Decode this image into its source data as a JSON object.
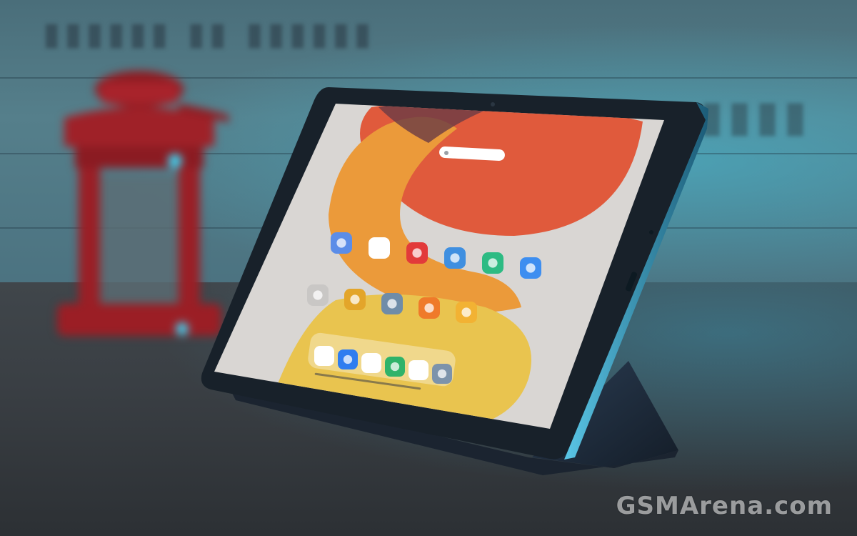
{
  "scene": {
    "description_colors": {
      "wall": "#4f7a86",
      "table": "#3a3f44",
      "lantern": "#a8232b",
      "tablet_frame": "#1f2a33",
      "cover": "#1c2a3a",
      "screen_bg": "#d9d6d3",
      "wallpaper_red": "#e05a3c",
      "wallpaper_orange": "#eb9a3a",
      "wallpaper_yellow": "#e9c44f"
    }
  },
  "tablet": {
    "status_bar": {
      "left": "",
      "right": ""
    },
    "home_row_1": [
      {
        "icon": "gallery-icon",
        "label": "",
        "color": "#5b8de8"
      },
      {
        "icon": "play-store-icon",
        "label": "",
        "color": "#ffffff"
      },
      {
        "icon": "recorder-icon",
        "label": "",
        "color": "#e23a3a"
      },
      {
        "icon": "weather-icon",
        "label": "",
        "color": "#3f8fe0"
      },
      {
        "icon": "scanner-icon",
        "label": "",
        "color": "#2dbb83"
      },
      {
        "icon": "browser-icon",
        "label": "",
        "color": "#3d8ef0"
      }
    ],
    "home_row_2": [
      {
        "icon": "folder-icon",
        "label": "",
        "color": "#c9c7c5"
      },
      {
        "icon": "notes-icon",
        "label": "",
        "color": "#e3a52a"
      },
      {
        "icon": "settings-icon",
        "label": "",
        "color": "#6f8ca8"
      },
      {
        "icon": "calculator-icon",
        "label": "",
        "color": "#ef7a2a"
      },
      {
        "icon": "cleaner-icon",
        "label": "",
        "color": "#f2b233"
      }
    ],
    "dock": [
      {
        "icon": "chrome-icon",
        "color": "#ffffff"
      },
      {
        "icon": "messages-icon",
        "color": "#2f7df0"
      },
      {
        "icon": "play-store-icon",
        "color": "#ffffff"
      },
      {
        "icon": "security-icon",
        "color": "#2fb36a"
      },
      {
        "icon": "camera-icon",
        "color": "#ffffff"
      },
      {
        "icon": "settings-icon",
        "color": "#7c93ab"
      }
    ]
  },
  "watermark": {
    "text": "GSMArena.com"
  }
}
